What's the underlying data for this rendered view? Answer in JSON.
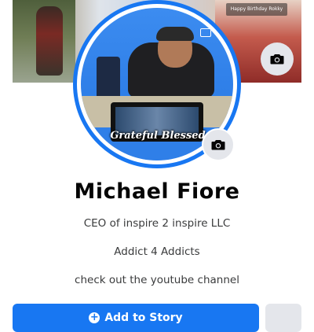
{
  "profile": {
    "name": "Michael Fiore",
    "bio": [
      "CEO of inspire 2 inspire LLC",
      "Addict 4 Addicts",
      "check out the youtube channel"
    ]
  },
  "avatar": {
    "overlay_text": "Grateful Blessed"
  },
  "cover": {
    "sign_text": "Happy Birthday Rokky"
  },
  "actions": {
    "add_story_label": "Add to Story",
    "add_story_icon": "plus-icon",
    "more_icon": "more-icon"
  },
  "icons": {
    "cover_camera": "camera-icon",
    "avatar_camera": "camera-icon"
  },
  "colors": {
    "accent": "#1877f2",
    "button_gray": "#e4e6eb",
    "text_primary": "#050505",
    "text_secondary": "#3a3b3c"
  }
}
